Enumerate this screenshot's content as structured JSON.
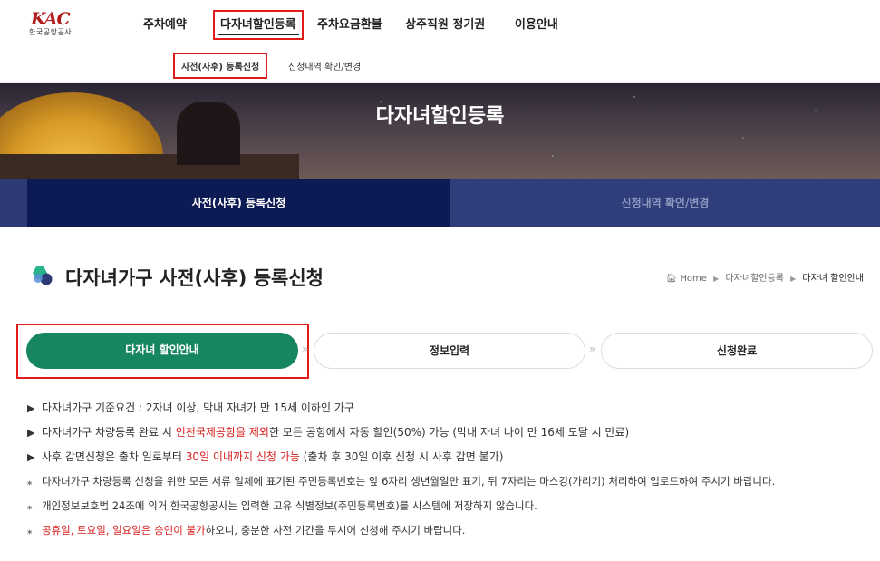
{
  "logo": {
    "mark": "KAC",
    "name": "한국공항공사"
  },
  "gnb": [
    {
      "label": "주차예약"
    },
    {
      "label": "다자녀할인등록"
    },
    {
      "label": "주차요금환불"
    },
    {
      "label": "상주직원 정기권"
    },
    {
      "label": "이용안내"
    }
  ],
  "subnav": [
    {
      "label": "사전(사후) 등록신청"
    },
    {
      "label": "신청내역 확인/변경"
    }
  ],
  "hero": {
    "title": "다자녀할인등록"
  },
  "tabs": [
    {
      "label": "사전(사후) 등록신청"
    },
    {
      "label": "신청내역 확인/변경"
    }
  ],
  "page": {
    "title": "다자녀가구 사전(사후) 등록신청",
    "breadcrumb": {
      "home": "Home",
      "level1": "다자녀할인등록",
      "current": "다자녀 할인안내"
    }
  },
  "steps": [
    {
      "label": "다자녀 할인안내"
    },
    {
      "label": "정보입력"
    },
    {
      "label": "신청완료"
    }
  ],
  "notes": {
    "n1": {
      "marker": "▶",
      "text": "다자녀가구 기준요건 : 2자녀 이상, 막내 자녀가 만 15세 이하인 가구"
    },
    "n2": {
      "marker": "▶",
      "pre": "다자녀가구 차량등록 완료 시 ",
      "red": "인천국제공항을 제외",
      "post": "한 모든 공항에서 자동 할인(50%) 가능 (막내 자녀 나이 만 16세 도달 시 만료)"
    },
    "n3": {
      "marker": "▶",
      "pre": "사후 감면신청은 출차 일로부터 ",
      "red": "30일 이내까지 신청 가능",
      "post": " (출차 후 30일 이후 신청 시 사후 감면 불가)"
    },
    "n4": {
      "marker": "⁎",
      "text": "다자녀가구 차량등록 신청을 위한 모든 서류 일체에 표기된 주민등록번호는 앞 6자리 생년월일만 표기, 뒤 7자리는 마스킹(가리기) 처리하여 업로드하여 주시기 바랍니다."
    },
    "n5": {
      "marker": "⁎",
      "text": "개인정보보호법 24조에 의거 한국공항공사는 입력한 고유 식별정보(주민등록번호)를 시스템에 저장하지 않습니다."
    },
    "n6": {
      "marker": "⁎",
      "red": "공휴일, 토요일, 일요일은 승인이 불가",
      "post": "하오니, 충분한 사전 기간을 두시어 신청해 주시기 바랍니다."
    }
  },
  "colors": {
    "brand_red": "#b11d1d",
    "highlight": "#e01b1b",
    "navy": "#0d1b55",
    "green": "#16865e",
    "alert": "#d81b1b"
  }
}
